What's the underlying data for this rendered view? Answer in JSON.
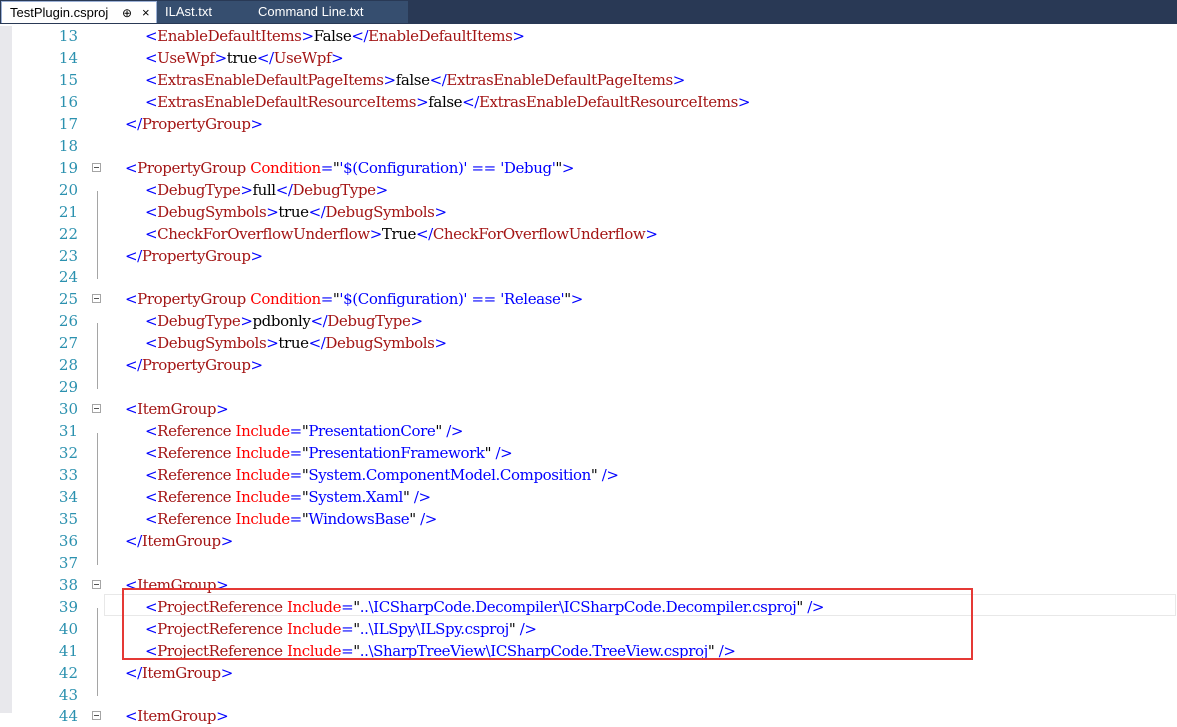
{
  "tabs": [
    {
      "label": "TestPlugin.csproj",
      "active": true,
      "pin": "⊕",
      "close": "×"
    },
    {
      "label": "ILAst.txt",
      "active": false
    },
    {
      "label": "Command Line.txt",
      "active": false
    }
  ],
  "lines": [
    {
      "n": "13",
      "indent": 2,
      "tokens": [
        [
          "p",
          "<"
        ],
        [
          "t",
          "EnableDefaultItems"
        ],
        [
          "p",
          ">"
        ],
        [
          "x",
          "False"
        ],
        [
          "p",
          "</"
        ],
        [
          "t",
          "EnableDefaultItems"
        ],
        [
          "p",
          ">"
        ]
      ]
    },
    {
      "n": "14",
      "indent": 2,
      "tokens": [
        [
          "p",
          "<"
        ],
        [
          "t",
          "UseWpf"
        ],
        [
          "p",
          ">"
        ],
        [
          "x",
          "true"
        ],
        [
          "p",
          "</"
        ],
        [
          "t",
          "UseWpf"
        ],
        [
          "p",
          ">"
        ]
      ]
    },
    {
      "n": "15",
      "indent": 2,
      "tokens": [
        [
          "p",
          "<"
        ],
        [
          "t",
          "ExtrasEnableDefaultPageItems"
        ],
        [
          "p",
          ">"
        ],
        [
          "x",
          "false"
        ],
        [
          "p",
          "</"
        ],
        [
          "t",
          "ExtrasEnableDefaultPageItems"
        ],
        [
          "p",
          ">"
        ]
      ]
    },
    {
      "n": "16",
      "indent": 2,
      "tokens": [
        [
          "p",
          "<"
        ],
        [
          "t",
          "ExtrasEnableDefaultResourceItems"
        ],
        [
          "p",
          ">"
        ],
        [
          "x",
          "false"
        ],
        [
          "p",
          "</"
        ],
        [
          "t",
          "ExtrasEnableDefaultResourceItems"
        ],
        [
          "p",
          ">"
        ]
      ]
    },
    {
      "n": "17",
      "indent": 1,
      "tokens": [
        [
          "p",
          "</"
        ],
        [
          "t",
          "PropertyGroup"
        ],
        [
          "p",
          ">"
        ]
      ]
    },
    {
      "n": "18",
      "indent": 0,
      "tokens": []
    },
    {
      "n": "19",
      "indent": 1,
      "fold": true,
      "tokens": [
        [
          "p",
          "<"
        ],
        [
          "t",
          "PropertyGroup"
        ],
        [
          "x",
          " "
        ],
        [
          "a",
          "Condition"
        ],
        [
          "p",
          "="
        ],
        [
          "x",
          "\""
        ],
        [
          "v",
          "'$(Configuration)' == 'Debug'"
        ],
        [
          "x",
          "\""
        ],
        [
          "p",
          ">"
        ]
      ]
    },
    {
      "n": "20",
      "indent": 2,
      "tokens": [
        [
          "p",
          "<"
        ],
        [
          "t",
          "DebugType"
        ],
        [
          "p",
          ">"
        ],
        [
          "x",
          "full"
        ],
        [
          "p",
          "</"
        ],
        [
          "t",
          "DebugType"
        ],
        [
          "p",
          ">"
        ]
      ]
    },
    {
      "n": "21",
      "indent": 2,
      "tokens": [
        [
          "p",
          "<"
        ],
        [
          "t",
          "DebugSymbols"
        ],
        [
          "p",
          ">"
        ],
        [
          "x",
          "true"
        ],
        [
          "p",
          "</"
        ],
        [
          "t",
          "DebugSymbols"
        ],
        [
          "p",
          ">"
        ]
      ]
    },
    {
      "n": "22",
      "indent": 2,
      "tokens": [
        [
          "p",
          "<"
        ],
        [
          "t",
          "CheckForOverflowUnderflow"
        ],
        [
          "p",
          ">"
        ],
        [
          "x",
          "True"
        ],
        [
          "p",
          "</"
        ],
        [
          "t",
          "CheckForOverflowUnderflow"
        ],
        [
          "p",
          ">"
        ]
      ]
    },
    {
      "n": "23",
      "indent": 1,
      "tokens": [
        [
          "p",
          "</"
        ],
        [
          "t",
          "PropertyGroup"
        ],
        [
          "p",
          ">"
        ]
      ]
    },
    {
      "n": "24",
      "indent": 0,
      "tokens": []
    },
    {
      "n": "25",
      "indent": 1,
      "fold": true,
      "tokens": [
        [
          "p",
          "<"
        ],
        [
          "t",
          "PropertyGroup"
        ],
        [
          "x",
          " "
        ],
        [
          "a",
          "Condition"
        ],
        [
          "p",
          "="
        ],
        [
          "x",
          "\""
        ],
        [
          "v",
          "'$(Configuration)' == 'Release'"
        ],
        [
          "x",
          "\""
        ],
        [
          "p",
          ">"
        ]
      ]
    },
    {
      "n": "26",
      "indent": 2,
      "tokens": [
        [
          "p",
          "<"
        ],
        [
          "t",
          "DebugType"
        ],
        [
          "p",
          ">"
        ],
        [
          "x",
          "pdbonly"
        ],
        [
          "p",
          "</"
        ],
        [
          "t",
          "DebugType"
        ],
        [
          "p",
          ">"
        ]
      ]
    },
    {
      "n": "27",
      "indent": 2,
      "tokens": [
        [
          "p",
          "<"
        ],
        [
          "t",
          "DebugSymbols"
        ],
        [
          "p",
          ">"
        ],
        [
          "x",
          "true"
        ],
        [
          "p",
          "</"
        ],
        [
          "t",
          "DebugSymbols"
        ],
        [
          "p",
          ">"
        ]
      ]
    },
    {
      "n": "28",
      "indent": 1,
      "tokens": [
        [
          "p",
          "</"
        ],
        [
          "t",
          "PropertyGroup"
        ],
        [
          "p",
          ">"
        ]
      ]
    },
    {
      "n": "29",
      "indent": 0,
      "tokens": []
    },
    {
      "n": "30",
      "indent": 1,
      "fold": true,
      "tokens": [
        [
          "p",
          "<"
        ],
        [
          "t",
          "ItemGroup"
        ],
        [
          "p",
          ">"
        ]
      ]
    },
    {
      "n": "31",
      "indent": 2,
      "tokens": [
        [
          "p",
          "<"
        ],
        [
          "t",
          "Reference"
        ],
        [
          "x",
          " "
        ],
        [
          "a",
          "Include"
        ],
        [
          "p",
          "="
        ],
        [
          "x",
          "\""
        ],
        [
          "v",
          "PresentationCore"
        ],
        [
          "x",
          "\""
        ],
        [
          "x",
          " "
        ],
        [
          "p",
          "/>"
        ]
      ]
    },
    {
      "n": "32",
      "indent": 2,
      "tokens": [
        [
          "p",
          "<"
        ],
        [
          "t",
          "Reference"
        ],
        [
          "x",
          " "
        ],
        [
          "a",
          "Include"
        ],
        [
          "p",
          "="
        ],
        [
          "x",
          "\""
        ],
        [
          "v",
          "PresentationFramework"
        ],
        [
          "x",
          "\""
        ],
        [
          "x",
          " "
        ],
        [
          "p",
          "/>"
        ]
      ]
    },
    {
      "n": "33",
      "indent": 2,
      "tokens": [
        [
          "p",
          "<"
        ],
        [
          "t",
          "Reference"
        ],
        [
          "x",
          " "
        ],
        [
          "a",
          "Include"
        ],
        [
          "p",
          "="
        ],
        [
          "x",
          "\""
        ],
        [
          "v",
          "System.ComponentModel.Composition"
        ],
        [
          "x",
          "\""
        ],
        [
          "x",
          " "
        ],
        [
          "p",
          "/>"
        ]
      ]
    },
    {
      "n": "34",
      "indent": 2,
      "tokens": [
        [
          "p",
          "<"
        ],
        [
          "t",
          "Reference"
        ],
        [
          "x",
          " "
        ],
        [
          "a",
          "Include"
        ],
        [
          "p",
          "="
        ],
        [
          "x",
          "\""
        ],
        [
          "v",
          "System.Xaml"
        ],
        [
          "x",
          "\""
        ],
        [
          "x",
          " "
        ],
        [
          "p",
          "/>"
        ]
      ]
    },
    {
      "n": "35",
      "indent": 2,
      "tokens": [
        [
          "p",
          "<"
        ],
        [
          "t",
          "Reference"
        ],
        [
          "x",
          " "
        ],
        [
          "a",
          "Include"
        ],
        [
          "p",
          "="
        ],
        [
          "x",
          "\""
        ],
        [
          "v",
          "WindowsBase"
        ],
        [
          "x",
          "\""
        ],
        [
          "x",
          " "
        ],
        [
          "p",
          "/>"
        ]
      ]
    },
    {
      "n": "36",
      "indent": 1,
      "tokens": [
        [
          "p",
          "</"
        ],
        [
          "t",
          "ItemGroup"
        ],
        [
          "p",
          ">"
        ]
      ]
    },
    {
      "n": "37",
      "indent": 0,
      "tokens": []
    },
    {
      "n": "38",
      "indent": 1,
      "fold": true,
      "tokens": [
        [
          "p",
          "<"
        ],
        [
          "t",
          "ItemGroup"
        ],
        [
          "p",
          ">"
        ]
      ]
    },
    {
      "n": "39",
      "indent": 2,
      "tokens": [
        [
          "p",
          "<"
        ],
        [
          "t",
          "ProjectReference"
        ],
        [
          "x",
          " "
        ],
        [
          "a",
          "Include"
        ],
        [
          "p",
          "="
        ],
        [
          "x",
          "\""
        ],
        [
          "v",
          "..\\ICSharpCode.Decompiler\\ICSharpCode.Decompiler.csproj"
        ],
        [
          "x",
          "\""
        ],
        [
          "x",
          " "
        ],
        [
          "p",
          "/>"
        ]
      ]
    },
    {
      "n": "40",
      "indent": 2,
      "tokens": [
        [
          "p",
          "<"
        ],
        [
          "t",
          "ProjectReference"
        ],
        [
          "x",
          " "
        ],
        [
          "a",
          "Include"
        ],
        [
          "p",
          "="
        ],
        [
          "x",
          "\""
        ],
        [
          "v",
          "..\\ILSpy\\ILSpy.csproj"
        ],
        [
          "x",
          "\""
        ],
        [
          "x",
          " "
        ],
        [
          "p",
          "/>"
        ]
      ]
    },
    {
      "n": "41",
      "indent": 2,
      "tokens": [
        [
          "p",
          "<"
        ],
        [
          "t",
          "ProjectReference"
        ],
        [
          "x",
          " "
        ],
        [
          "a",
          "Include"
        ],
        [
          "p",
          "="
        ],
        [
          "x",
          "\""
        ],
        [
          "v",
          "..\\SharpTreeView\\ICSharpCode.TreeView.csproj"
        ],
        [
          "x",
          "\""
        ],
        [
          "x",
          " "
        ],
        [
          "p",
          "/>"
        ]
      ]
    },
    {
      "n": "42",
      "indent": 1,
      "tokens": [
        [
          "p",
          "</"
        ],
        [
          "t",
          "ItemGroup"
        ],
        [
          "p",
          ">"
        ]
      ]
    },
    {
      "n": "43",
      "indent": 0,
      "tokens": []
    },
    {
      "n": "44",
      "indent": 1,
      "fold": true,
      "tokens": [
        [
          "p",
          "<"
        ],
        [
          "t",
          "ItemGroup"
        ],
        [
          "p",
          ">"
        ]
      ]
    }
  ]
}
